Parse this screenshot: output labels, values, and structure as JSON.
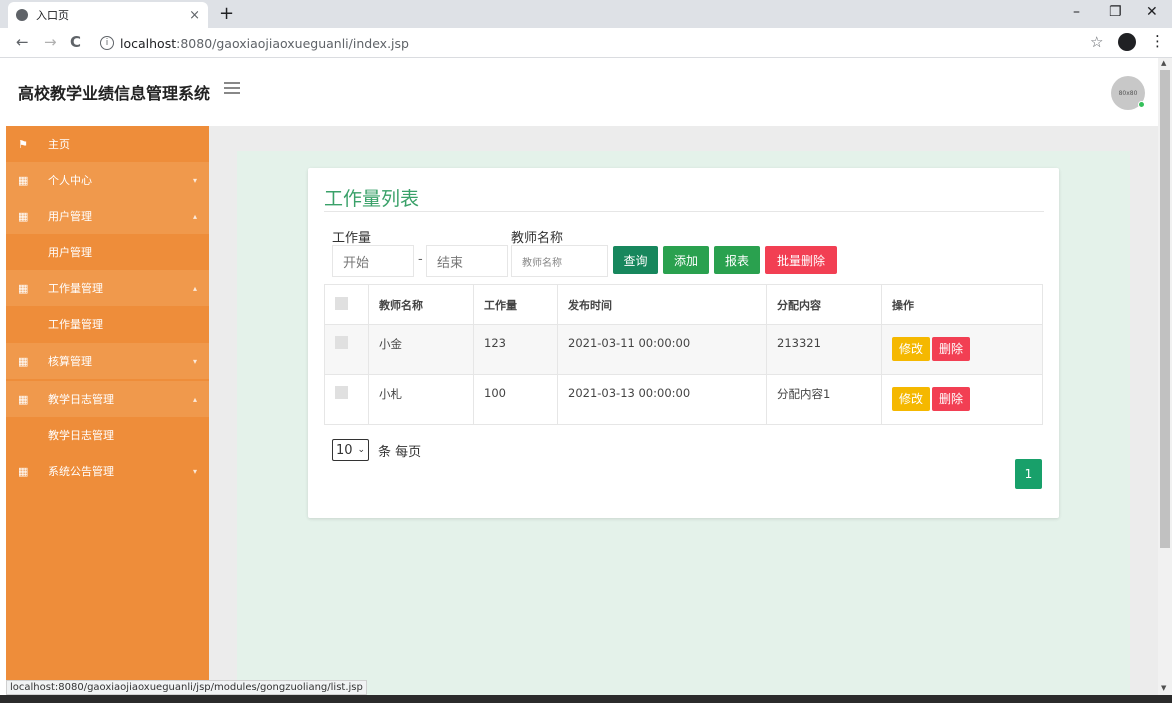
{
  "browser": {
    "tab_title": "入口页",
    "tab_close": "×",
    "new_tab": "+",
    "minimize": "–",
    "restore": "❐",
    "close": "✕",
    "back": "←",
    "forward": "→",
    "reload": "C",
    "url_host": "localhost",
    "url_path": ":8080/gaoxiaojiaoxueguanli/index.jsp",
    "bookmark": "☆",
    "menu": "⋮"
  },
  "app": {
    "title": "高校教学业绩信息管理系统",
    "avatar_text": "80x80"
  },
  "sidebar": {
    "items": [
      {
        "icon": "flag-icon",
        "label": "主页",
        "arrow": ""
      },
      {
        "icon": "grid-icon",
        "label": "个人中心",
        "arrow": "▾"
      },
      {
        "icon": "grid-icon",
        "label": "用户管理",
        "arrow": "▴"
      },
      {
        "label": "用户管理"
      },
      {
        "icon": "grid-icon",
        "label": "工作量管理",
        "arrow": "▴"
      },
      {
        "label": "工作量管理"
      },
      {
        "icon": "grid-icon",
        "label": "核算管理",
        "arrow": "▾"
      },
      {
        "icon": "grid-icon",
        "label": "教学日志管理",
        "arrow": "▴"
      },
      {
        "label": "教学日志管理"
      },
      {
        "icon": "grid-icon",
        "label": "系统公告管理",
        "arrow": "▾"
      }
    ]
  },
  "page": {
    "title": "工作量列表",
    "filter": {
      "workload_label": "工作量",
      "start_placeholder": "开始",
      "dash": "-",
      "end_placeholder": "结束",
      "teacher_label": "教师名称",
      "teacher_placeholder": "教师名称"
    },
    "buttons": {
      "query": "查询",
      "add": "添加",
      "report": "报表",
      "batch_delete": "批量删除"
    },
    "table": {
      "headers": [
        "教师名称",
        "工作量",
        "发布时间",
        "分配内容",
        "操作"
      ],
      "rows": [
        {
          "teacher": "小金",
          "workload": "123",
          "time": "2021-03-11 00:00:00",
          "content": "213321"
        },
        {
          "teacher": "小札",
          "workload": "100",
          "time": "2021-03-13 00:00:00",
          "content": "分配内容1"
        }
      ],
      "edit_label": "修改",
      "delete_label": "删除"
    },
    "pager": {
      "page_size": "10",
      "page_size_suffix": "条 每页",
      "current_page": "1"
    }
  },
  "status_url": "localhost:8080/gaoxiaojiaoxueguanli/jsp/modules/gongzuoliang/list.jsp",
  "colors": {
    "sidebar": "#ee8d3a",
    "accent_green": "#3aa169",
    "query_btn": "#17875d",
    "add_btn": "#2aa14f",
    "report_btn": "#2aa14f",
    "batch_delete_btn": "#f23f53",
    "edit_btn": "#f5b800",
    "delete_btn": "#f23f53"
  }
}
